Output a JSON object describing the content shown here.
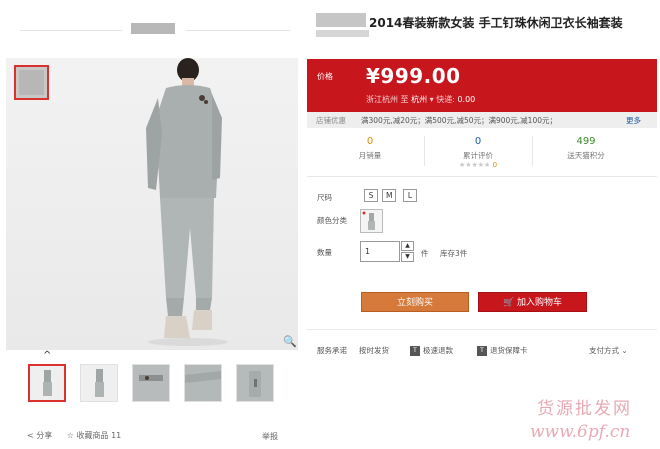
{
  "product": {
    "title": "2014春装新款女装 手工钉珠休闲卫衣长袖套装"
  },
  "price": {
    "label": "价格",
    "value": "¥999.00",
    "origin": "浙江杭州",
    "to_text": "至",
    "destination": "杭州",
    "shipping_label": "快递:",
    "shipping_value": "0.00"
  },
  "promotions": {
    "label": "店铺优惠",
    "items": "满300元,减20元；满500元,减50元；满900元,减100元；",
    "more_label": "更多"
  },
  "stats": [
    {
      "value": "0",
      "label": "月销量"
    },
    {
      "value": "0",
      "label": "累计评价"
    },
    {
      "value": "499",
      "label": "送天猫积分"
    }
  ],
  "review_count": "0",
  "options": {
    "size_label": "尺码",
    "sizes": [
      "S",
      "M",
      "L"
    ],
    "color_label": "颜色分类",
    "quantity_label": "数量",
    "quantity_value": "1",
    "unit": "件",
    "stock": "库存3件"
  },
  "actions": {
    "buy_now": "立刻购买",
    "add_to_cart": "加入购物车"
  },
  "services": {
    "label": "服务承诺",
    "items": [
      {
        "tag": "",
        "text": "按时发货"
      },
      {
        "tag": "T",
        "text": "极速退款"
      },
      {
        "tag": "T",
        "text": "退货保障卡"
      }
    ],
    "payment_label": "支付方式"
  },
  "bottom": {
    "share": "分享",
    "favorite": "收藏商品",
    "favorite_count": "11",
    "report": "举报"
  },
  "watermark": {
    "line1": "货源批发网",
    "line2": "www.6pf.cn"
  },
  "colors": {
    "accent": "#c8161d",
    "buy_button": "#d57a3b",
    "link": "#1e5aa8"
  }
}
